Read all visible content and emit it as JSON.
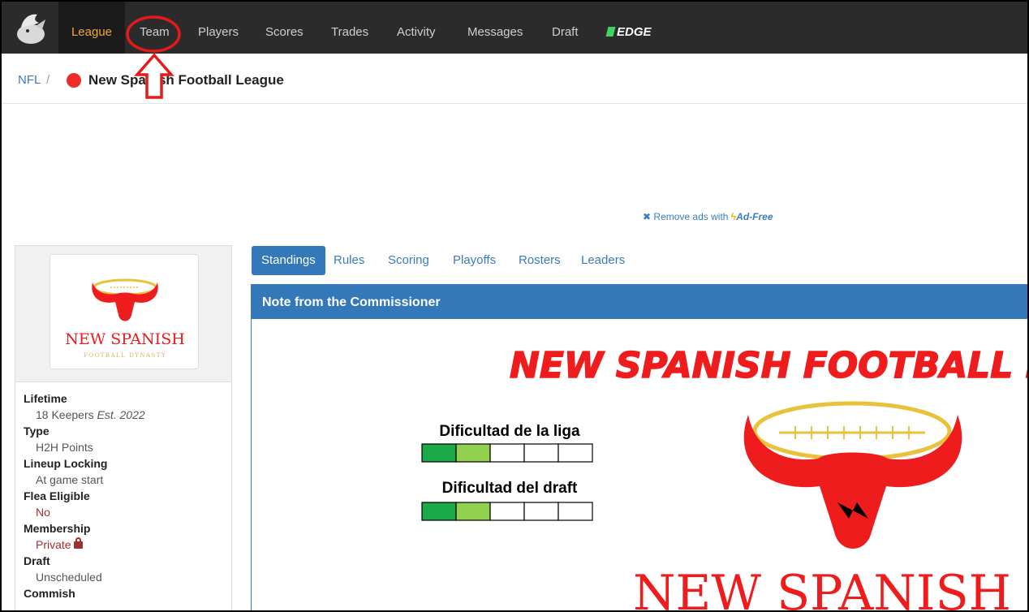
{
  "nav": {
    "items": [
      {
        "label": "League",
        "active": true
      },
      {
        "label": "Team"
      },
      {
        "label": "Players"
      },
      {
        "label": "Scores"
      },
      {
        "label": "Trades"
      },
      {
        "label": "Activity"
      },
      {
        "label": "Messages"
      },
      {
        "label": "Draft"
      }
    ],
    "edge_label": "EDGE"
  },
  "breadcrumb": {
    "sport": "NFL",
    "separator": "/",
    "league_name": "New Spanish Football League",
    "league_color": "#ef2b2b"
  },
  "ad": {
    "text": "Remove ads with",
    "link": "Ad-Free",
    "icon": "close-icon",
    "bolt_icon": "lightning-icon"
  },
  "sidebar": {
    "logo_title": "NEW SPANISH",
    "logo_subtitle": "FOOTBALL DYNASTY",
    "info": [
      {
        "label": "Lifetime",
        "value": "18 Keepers",
        "extra": "Est. 2022"
      },
      {
        "label": "Type",
        "value": "H2H Points"
      },
      {
        "label": "Lineup Locking",
        "value": "At game start"
      },
      {
        "label": "Flea Eligible",
        "value": "No",
        "highlight": true
      },
      {
        "label": "Membership",
        "value": "Private",
        "highlight": true,
        "icon": "lock-icon"
      },
      {
        "label": "Draft",
        "value": "Unscheduled"
      },
      {
        "label": "Commish",
        "value": ""
      }
    ]
  },
  "tabs": [
    {
      "label": "Standings",
      "active": true
    },
    {
      "label": "Rules"
    },
    {
      "label": "Scoring"
    },
    {
      "label": "Playoffs"
    },
    {
      "label": "Rosters"
    },
    {
      "label": "Leaders"
    }
  ],
  "commissioner_note": {
    "header": "Note from the Commissioner",
    "banner_title": "NEW SPANISH FOOTBALL DY",
    "difficulty": [
      {
        "label": "Dificultad de la liga",
        "filled": 2,
        "total": 5
      },
      {
        "label": "Dificultad del draft",
        "filled": 2,
        "total": 5
      }
    ],
    "logo_text": "NEW SPANISH"
  },
  "colors": {
    "accent_blue": "#3378b8",
    "nav_active": "#f0a830",
    "brand_red": "#ef2020",
    "difficulty_dark": "#1aaa4a",
    "difficulty_light": "#92d050",
    "annotation_red": "#e61a1a"
  },
  "annotation": {
    "target": "Team",
    "shape": "circle-with-arrow"
  }
}
